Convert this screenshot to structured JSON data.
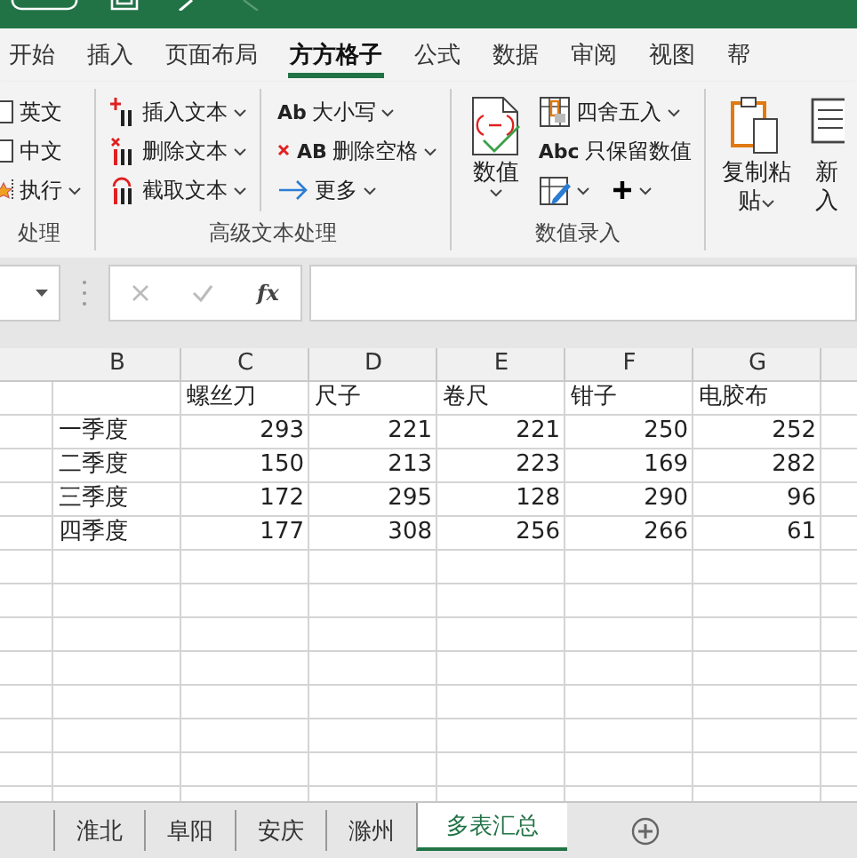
{
  "ribbon_tabs": [
    {
      "label": "开始",
      "selected": false
    },
    {
      "label": "插入",
      "selected": false
    },
    {
      "label": "页面布局",
      "selected": false
    },
    {
      "label": "方方格子",
      "selected": true
    },
    {
      "label": "公式",
      "selected": false
    },
    {
      "label": "数据",
      "selected": false
    },
    {
      "label": "审阅",
      "selected": false
    },
    {
      "label": "视图",
      "selected": false
    },
    {
      "label": "帮",
      "selected": false
    }
  ],
  "ribbon_groups": [
    {
      "label": "处理",
      "columns": [
        [
          {
            "label": "英文",
            "dropdown": false
          },
          {
            "label": "中文",
            "dropdown": false
          },
          {
            "label": "执行",
            "dropdown": true
          }
        ]
      ]
    },
    {
      "label": "高级文本处理",
      "columns": [
        [
          {
            "label": "插入文本",
            "dropdown": true
          },
          {
            "label": "删除文本",
            "dropdown": true
          },
          {
            "label": "截取文本",
            "dropdown": true
          }
        ],
        [
          {
            "glyph": "Ab",
            "label": "大小写",
            "dropdown": true
          },
          {
            "glyph": "AB",
            "label": "删除空格",
            "dropdown": true
          },
          {
            "label": "更多",
            "dropdown": true
          }
        ]
      ]
    },
    {
      "label": "数值录入",
      "large": [
        {
          "lines": [
            "数值"
          ],
          "dropdown": true
        }
      ],
      "columns": [
        [
          {
            "label": "四舍五入",
            "dropdown": true
          },
          {
            "glyph": "Abc",
            "label": "只保留数值",
            "dropdown": false
          },
          {
            "buttons": [
              {
                "dropdown": true
              },
              {
                "dropdown": true
              }
            ]
          }
        ]
      ]
    },
    {
      "large": [
        {
          "lines": [
            "复制粘",
            "贴"
          ],
          "dropdown": true
        },
        {
          "lines": [
            "新",
            "入"
          ],
          "dropdown": false
        }
      ]
    }
  ],
  "formula_bar": {
    "function_label": "fx"
  },
  "sheet": {
    "column_headers": [
      "B",
      "C",
      "D",
      "E",
      "F",
      "G"
    ],
    "header_row": [
      "螺丝刀",
      "尺子",
      "卷尺",
      "钳子",
      "电胶布"
    ],
    "rows": [
      {
        "label": "一季度",
        "values": [
          "293",
          "221",
          "221",
          "250",
          "252"
        ]
      },
      {
        "label": "二季度",
        "values": [
          "150",
          "213",
          "223",
          "169",
          "282"
        ]
      },
      {
        "label": "三季度",
        "values": [
          "172",
          "295",
          "128",
          "290",
          "96"
        ]
      },
      {
        "label": "四季度",
        "values": [
          "177",
          "308",
          "256",
          "266",
          "61"
        ]
      }
    ]
  },
  "sheet_tabs": [
    {
      "label": "淮北",
      "selected": false
    },
    {
      "label": "阜阳",
      "selected": false
    },
    {
      "label": "安庆",
      "selected": false
    },
    {
      "label": "滁州",
      "selected": false
    },
    {
      "label": "多表汇总",
      "selected": true
    }
  ]
}
